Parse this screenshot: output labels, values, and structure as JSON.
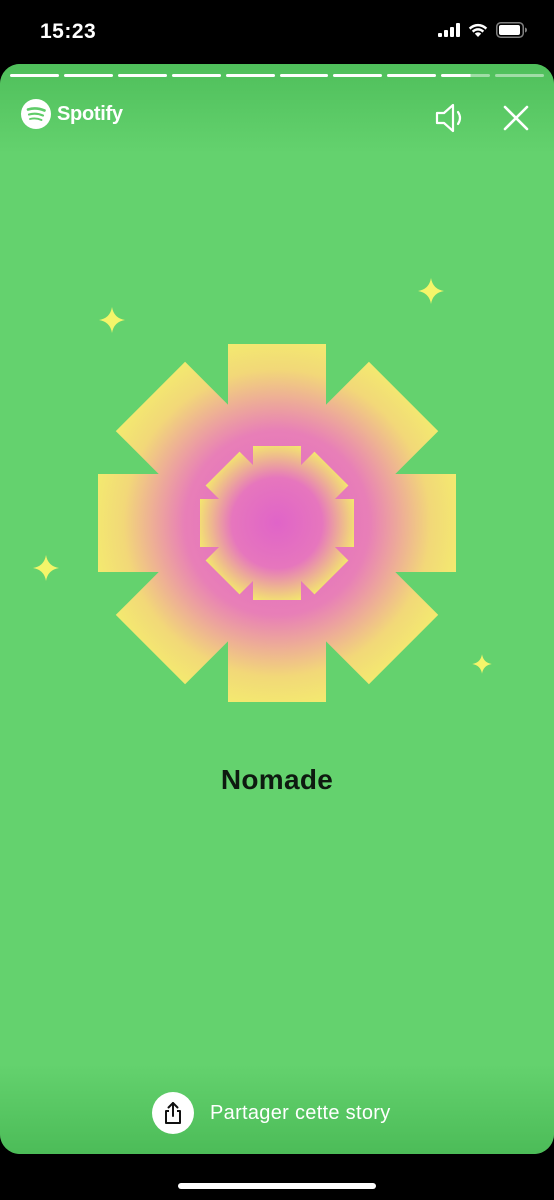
{
  "status": {
    "time": "15:23"
  },
  "story": {
    "brand": "Spotify",
    "progress_total": 10,
    "progress_completed": 8,
    "progress_current_fraction": 0.6,
    "title": "Nomade",
    "share_label": "Partager cette story"
  },
  "icons": {
    "brand": "spotify-logo-icon",
    "sound": "speaker-icon",
    "close": "close-icon",
    "share": "share-icon"
  },
  "colors": {
    "background": "#64d26e",
    "art_yellow": "#f4f56a",
    "art_pink": "#e46bc9",
    "sparkle": "#f4f56a"
  }
}
